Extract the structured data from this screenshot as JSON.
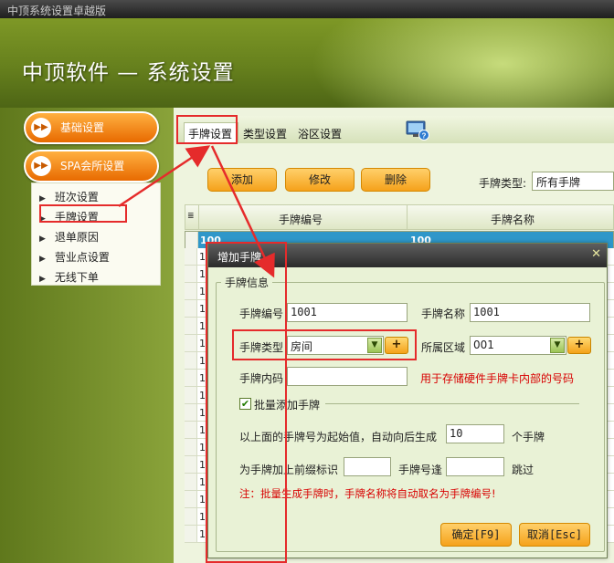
{
  "window": {
    "title": "中顶系统设置卓越版"
  },
  "banner": {
    "title": "中顶软件 — 系统设置"
  },
  "sidebar": {
    "groups": [
      {
        "label": "基础设置",
        "icon": "double-arrow-icon"
      },
      {
        "label": "SPA会所设置",
        "icon": "double-arrow-icon"
      }
    ],
    "items": [
      {
        "label": "班次设置"
      },
      {
        "label": "手牌设置"
      },
      {
        "label": "退单原因"
      },
      {
        "label": "营业点设置"
      },
      {
        "label": "无线下单"
      }
    ]
  },
  "tabs": [
    {
      "label": "手牌设置",
      "active": true
    },
    {
      "label": "类型设置",
      "active": false
    },
    {
      "label": "浴区设置",
      "active": false
    }
  ],
  "toolbar": {
    "add": "添加",
    "edit": "修改",
    "delete": "删除",
    "filter_label": "手牌类型:",
    "filter_value": "所有手牌"
  },
  "grid": {
    "columns": [
      "手牌编号",
      "手牌名称"
    ],
    "rows": [
      {
        "id": "100",
        "name": "100"
      },
      {
        "id": "10",
        "name": ""
      },
      {
        "id": "10",
        "name": ""
      },
      {
        "id": "10",
        "name": ""
      },
      {
        "id": "10",
        "name": ""
      },
      {
        "id": "10",
        "name": ""
      },
      {
        "id": "10",
        "name": ""
      },
      {
        "id": "10",
        "name": ""
      },
      {
        "id": "10",
        "name": ""
      },
      {
        "id": "10",
        "name": ""
      },
      {
        "id": "10",
        "name": ""
      },
      {
        "id": "10",
        "name": ""
      },
      {
        "id": "10",
        "name": ""
      },
      {
        "id": "10",
        "name": ""
      },
      {
        "id": "10",
        "name": ""
      },
      {
        "id": "10",
        "name": ""
      },
      {
        "id": "10",
        "name": ""
      },
      {
        "id": "10",
        "name": ""
      }
    ]
  },
  "dialog": {
    "title": "增加手牌",
    "close": "✕",
    "section": "手牌信息",
    "card_no_label": "手牌编号",
    "card_no_value": "1001",
    "card_name_label": "手牌名称",
    "card_name_value": "1001",
    "card_type_label": "手牌类型",
    "card_type_value": "房间",
    "area_label": "所属区域",
    "area_value": "001",
    "inner_code_label": "手牌内码",
    "inner_code_value": "",
    "inner_code_hint": "用于存储硬件手牌卡内部的号码",
    "batch_label": "批量添加手牌",
    "batch_checked": true,
    "batch_start_label": "以上面的手牌号为起始值，自动向后生成",
    "batch_count": "10",
    "batch_count_unit": "个手牌",
    "prefix_label": "为手牌加上前缀标识",
    "prefix_value": "",
    "skip_label": "手牌号逢",
    "skip_value": "",
    "skip_unit": "跳过",
    "note": "注：批量生成手牌时，手牌名称将自动取名为手牌编号!",
    "ok": "确定[F9]",
    "cancel": "取消[Esc]"
  },
  "colors": {
    "banner": "#66801d",
    "orange_button": "#f5a11b",
    "highlight_box": "#e52b2b",
    "selected_row": "#2f97c9"
  }
}
